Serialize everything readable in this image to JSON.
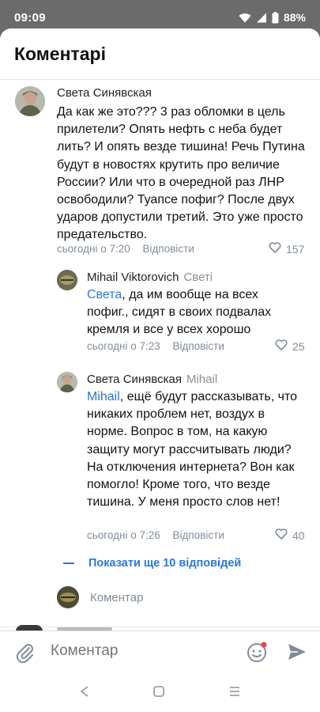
{
  "status_bar": {
    "time": "09:09",
    "battery": "88%"
  },
  "sheet": {
    "title": "Коментарі"
  },
  "comments": [
    {
      "author": "Света Синявская",
      "reply_to": "",
      "mention": "",
      "text": "Да как же это??? 3 раз обломки в цель прилетели? Опять нефть с неба будет лить? И опять везде тишина! Речь Путина будут в новостях крутить про величие России? Или что в очередной раз ЛНР освободили? Туапсе пофиг? После двух ударов допустили третий. Это уже просто предательство.",
      "time": "сьогодні о 7:20",
      "reply_label": "Відповісти",
      "likes": "157"
    },
    {
      "author": "Mihail Viktorovich",
      "reply_to": "Светі",
      "mention": "Света",
      "text": ", да им вообще на всех пофиг., сидят в своих подвалах кремля и все у всех хорошо",
      "time": "сьогодні о 7:23",
      "reply_label": "Відповісти",
      "likes": "25"
    },
    {
      "author": "Света Синявская",
      "reply_to": "Mihail",
      "mention": "Mihail",
      "text": ", ещё будут рассказывать, что никаких проблем нет, воздух в норме. Вопрос в том, на какую защиту могут рассчитывать люди? На отключения интернета? Вон как помогло! Кроме того, что везде тишина. У меня просто слов нет!",
      "time": "сьогодні о 7:26",
      "reply_label": "Відповісти",
      "likes": "40"
    }
  ],
  "more_replies": "Показати ще 10 відповідей",
  "inline_compose": {
    "placeholder": "Коментар"
  },
  "input_bar": {
    "placeholder": "Коментар"
  },
  "colors": {
    "accent": "#2a77d8",
    "secondary_text": "#818c99",
    "backdrop": "#6b6b6b"
  },
  "icons": [
    "wifi-icon",
    "signal-icon",
    "battery-icon",
    "heart-icon",
    "attach-icon",
    "emoji-icon",
    "send-icon",
    "back-nav-icon",
    "home-nav-icon",
    "recents-nav-icon"
  ]
}
